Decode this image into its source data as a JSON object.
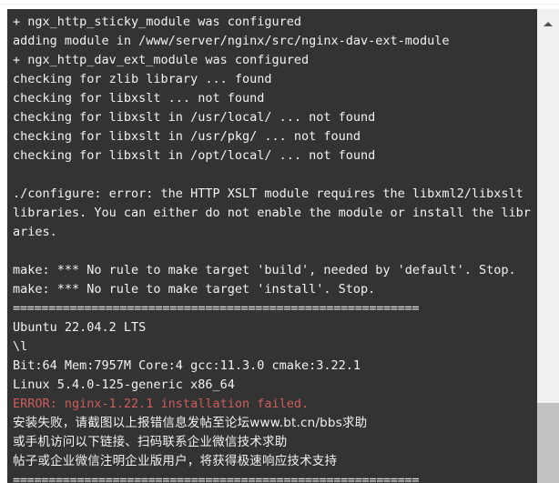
{
  "console": {
    "lines": [
      {
        "text": "+ ngx_http_sticky_module was configured",
        "style": "normal"
      },
      {
        "text": "adding module in /www/server/nginx/src/nginx-dav-ext-module",
        "style": "normal"
      },
      {
        "text": "+ ngx_http_dav_ext_module was configured",
        "style": "normal"
      },
      {
        "text": "checking for zlib library ... found",
        "style": "normal"
      },
      {
        "text": "checking for libxslt ... not found",
        "style": "normal"
      },
      {
        "text": "checking for libxslt in /usr/local/ ... not found",
        "style": "normal"
      },
      {
        "text": "checking for libxslt in /usr/pkg/ ... not found",
        "style": "normal"
      },
      {
        "text": "checking for libxslt in /opt/local/ ... not found",
        "style": "normal"
      },
      {
        "text": "",
        "style": "blank"
      },
      {
        "text": "./configure: error: the HTTP XSLT module requires the libxml2/libxslt libraries. You can either do not enable the module or install the libraries.",
        "style": "normal"
      },
      {
        "text": "",
        "style": "blank"
      },
      {
        "text": "make: *** No rule to make target 'build', needed by 'default'. Stop.",
        "style": "normal"
      },
      {
        "text": "make: *** No rule to make target 'install'. Stop.",
        "style": "normal"
      },
      {
        "text": "=========================================================",
        "style": "sep"
      },
      {
        "text": "Ubuntu 22.04.2 LTS",
        "style": "normal"
      },
      {
        "text": "\\l",
        "style": "normal"
      },
      {
        "text": "Bit:64 Mem:7957M Core:4 gcc:11.3.0 cmake:3.22.1",
        "style": "normal"
      },
      {
        "text": "Linux 5.4.0-125-generic x86_64",
        "style": "normal"
      },
      {
        "text": "ERROR: nginx-1.22.1 installation failed.",
        "style": "error"
      },
      {
        "text": "安装失败，请截图以上报错信息发帖至论坛www.bt.cn/bbs求助",
        "style": "cjk"
      },
      {
        "text": "或手机访问以下链接、扫码联系企业微信技术求助",
        "style": "cjk"
      },
      {
        "text": "帖子或企业微信注明企业版用户，将获得极速响应技术支持",
        "style": "cjk"
      },
      {
        "text": "=========================================================",
        "style": "sep"
      }
    ]
  },
  "scrollbar": {
    "up_arrow_name": "scroll-up-arrow"
  },
  "colors": {
    "console_background": "#333333",
    "console_text": "#f2f2f2",
    "error_text": "#cd5c5c",
    "scrollbar_track": "#f0f0f0",
    "scrollbar_thumb": "#c2c2c2",
    "page_background": "#ffffff"
  }
}
